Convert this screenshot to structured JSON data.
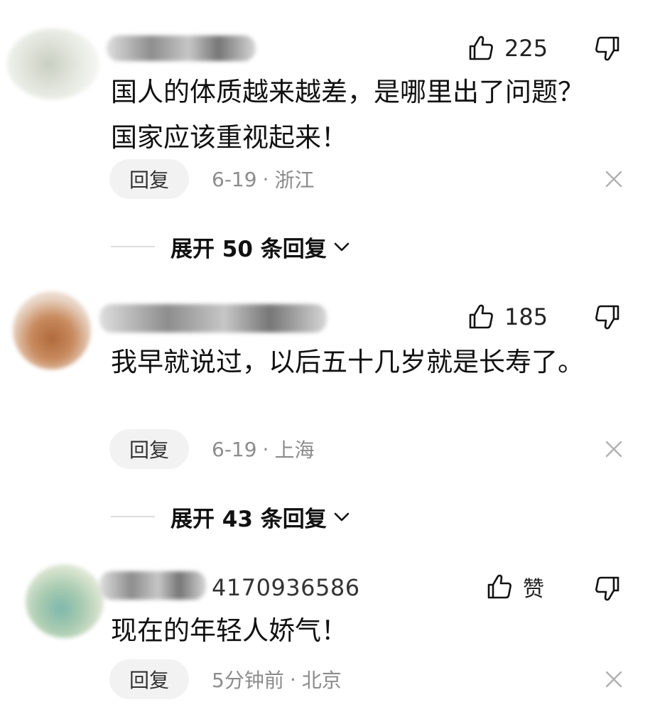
{
  "comments": [
    {
      "username": "",
      "likes": "225",
      "text": "国人的体质越来越差，是哪里出了问题？国家应该重视起来！",
      "reply_label": "回复",
      "date": "6-19",
      "separator": "·",
      "location": "浙江",
      "expand_label": "展开 50 条回复"
    },
    {
      "username": "",
      "likes": "185",
      "text": "我早就说过，以后五十几岁就是长寿了。",
      "reply_label": "回复",
      "date": "6-19",
      "separator": "·",
      "location": "上海",
      "expand_label": "展开 43 条回复"
    },
    {
      "username": "4170936586",
      "likes": "赞",
      "text": "现在的年轻人娇气！",
      "reply_label": "回复",
      "date": "5分钟前",
      "separator": "·",
      "location": "北京"
    }
  ],
  "icons": {
    "like": "thumbs-up-icon",
    "dislike": "thumbs-down-icon",
    "close": "close-icon",
    "expand": "chevron-down-icon"
  },
  "colors": {
    "text": "#111111",
    "meta": "#8c8c8c",
    "reply_bg": "#f2f2f2",
    "divider": "#dddddd"
  }
}
